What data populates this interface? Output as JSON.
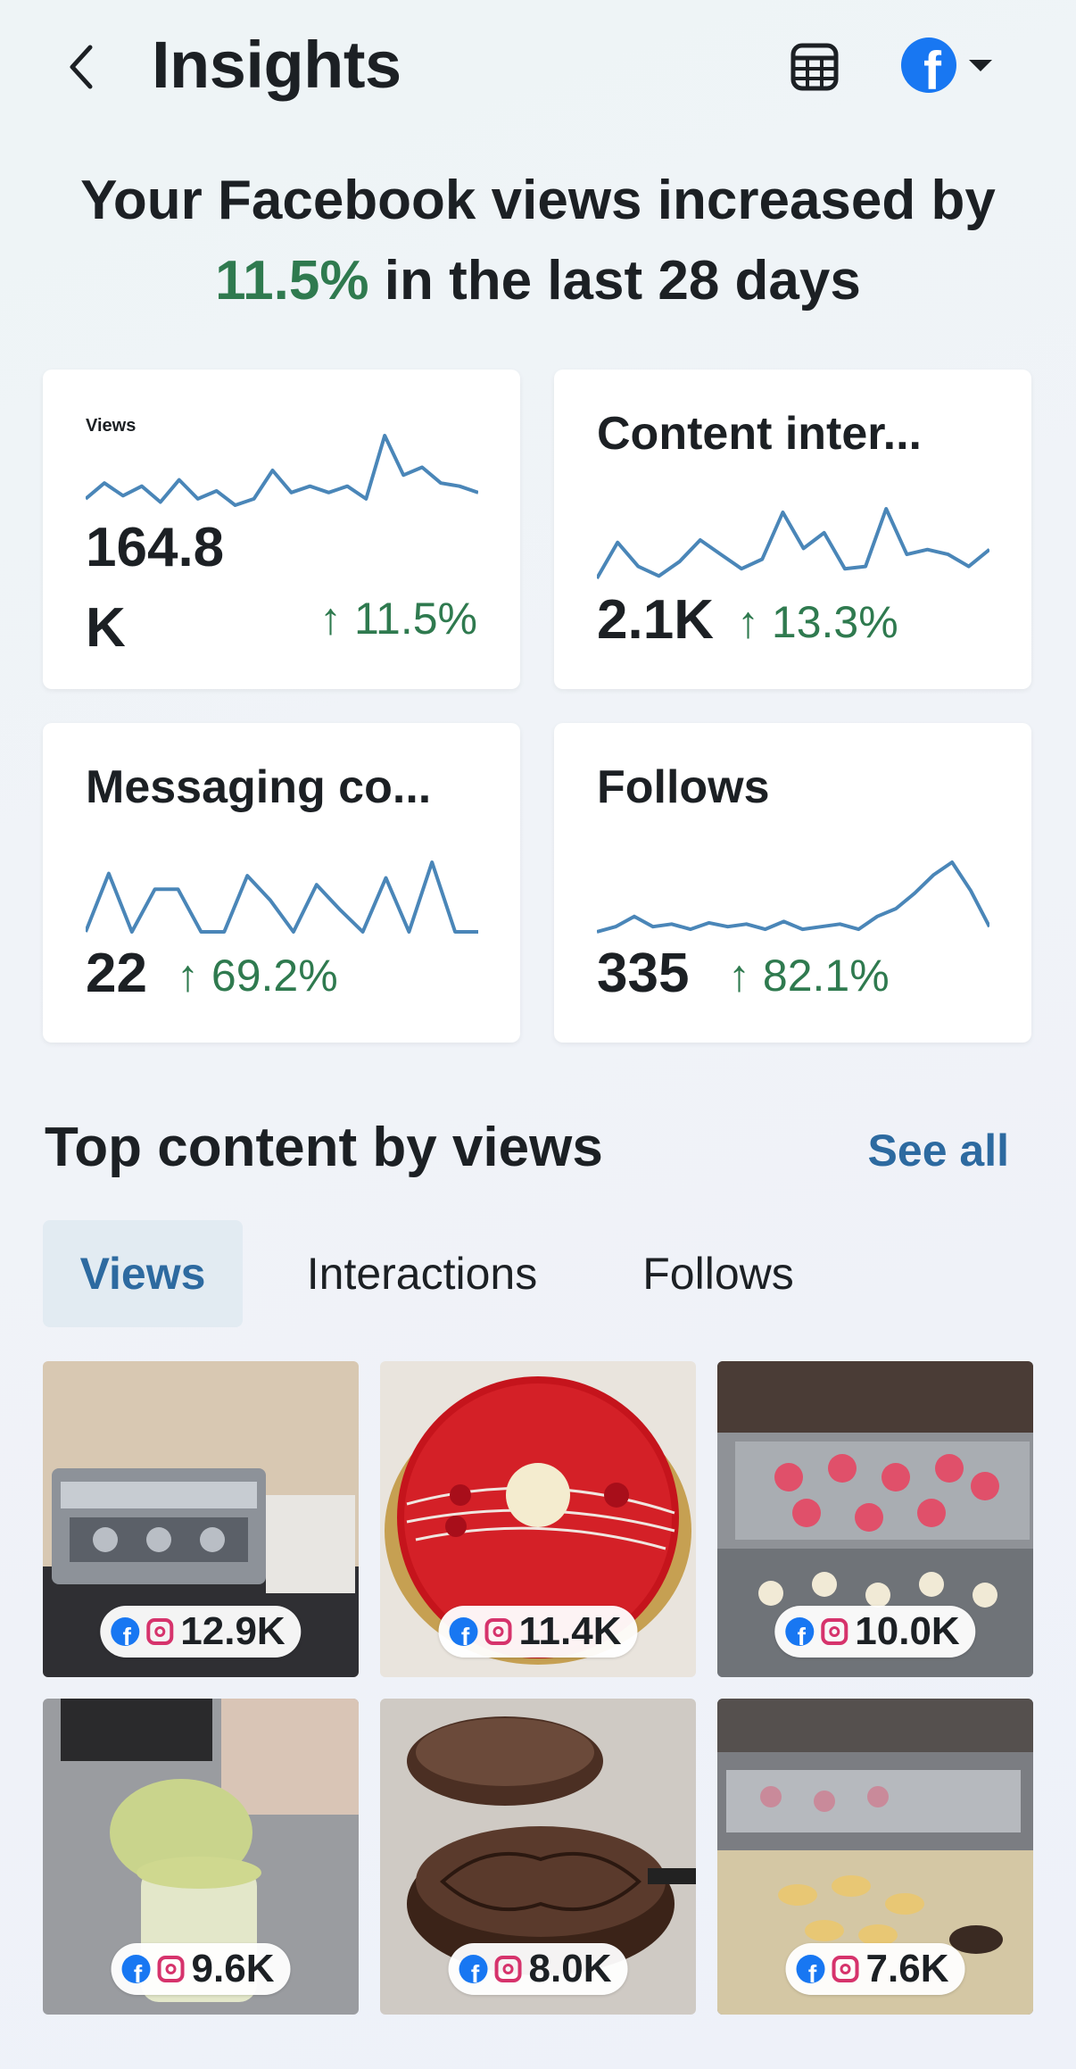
{
  "header": {
    "title": "Insights"
  },
  "headline": {
    "prefix": "Your Facebook views increased by",
    "percent": "11.5%",
    "suffix": "in the last 28 days"
  },
  "metrics": [
    {
      "title": "Views",
      "value": "164.8 K",
      "delta": "↑ 11.5%",
      "sparkline": [
        30,
        40,
        32,
        38,
        28,
        42,
        30,
        35,
        26,
        30,
        48,
        34,
        38,
        34,
        38,
        30,
        70,
        45,
        50,
        40,
        38,
        34
      ]
    },
    {
      "title": "Content inter...",
      "value": "2.1K",
      "delta": "↑ 13.3%",
      "sparkline": [
        20,
        50,
        30,
        22,
        34,
        52,
        40,
        28,
        36,
        75,
        45,
        58,
        28,
        30,
        78,
        40,
        44,
        40,
        30,
        44
      ]
    },
    {
      "title": "Messaging co...",
      "value": "22",
      "delta": "↑ 69.2%",
      "sparkline": [
        10,
        62,
        10,
        48,
        48,
        10,
        10,
        60,
        38,
        10,
        52,
        30,
        10,
        58,
        10,
        72,
        10,
        10
      ]
    },
    {
      "title": "Follows",
      "value": "335",
      "delta": "↑ 82.1%",
      "sparkline": [
        18,
        22,
        30,
        22,
        24,
        20,
        25,
        22,
        24,
        20,
        26,
        20,
        22,
        24,
        20,
        30,
        36,
        48,
        62,
        72,
        50,
        22
      ]
    }
  ],
  "top_content": {
    "title": "Top content by views",
    "see_all": "See all",
    "tabs": [
      "Views",
      "Interactions",
      "Follows"
    ],
    "active_tab": "Views",
    "items": [
      {
        "subject": "espresso machine",
        "views": "12.9K"
      },
      {
        "subject": "red glazed cake",
        "views": "11.4K"
      },
      {
        "subject": "pastry display case",
        "views": "10.0K"
      },
      {
        "subject": "matcha drink prep",
        "views": "9.6K"
      },
      {
        "subject": "chocolate tart",
        "views": "8.0K"
      },
      {
        "subject": "tart display case",
        "views": "7.6K"
      }
    ]
  },
  "colors": {
    "accent_blue": "#2d6aa0",
    "positive_green": "#2f7a4f",
    "spark_line": "#4a86b8",
    "facebook_blue": "#1877f2",
    "instagram_pink": "#d6336c"
  }
}
